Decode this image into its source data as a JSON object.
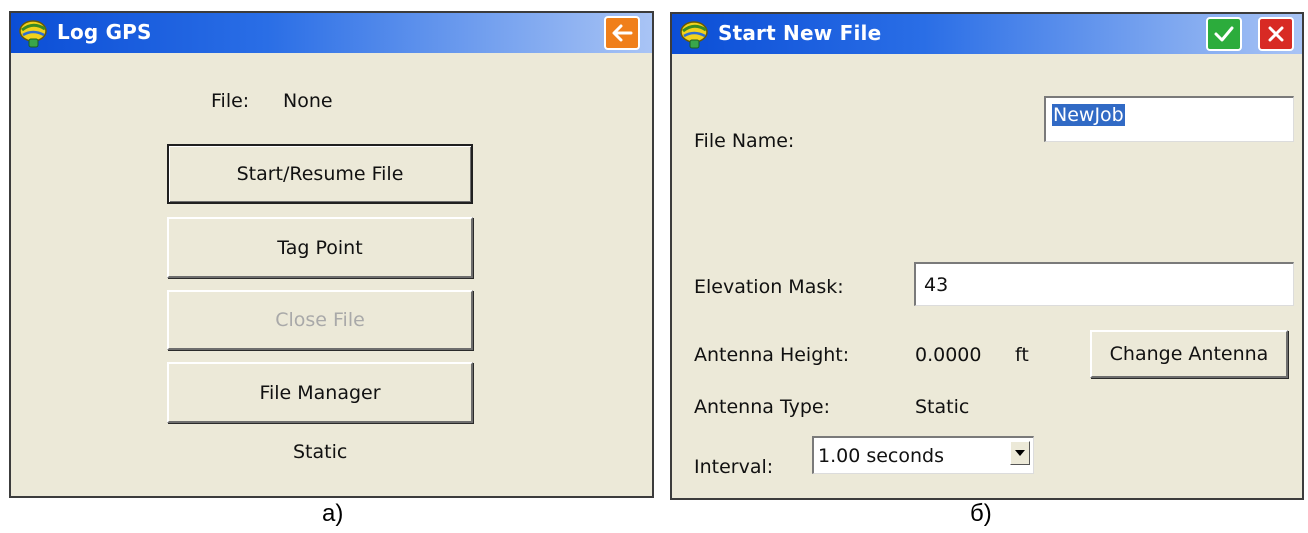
{
  "panel_a": {
    "title": "Log GPS",
    "file_label": "File:",
    "file_value": "None",
    "buttons": {
      "start_resume": "Start/Resume File",
      "tag_point": "Tag Point",
      "close_file": "Close File",
      "file_manager": "File Manager"
    },
    "mode_value": "Static",
    "caption": "a)",
    "icons": {
      "back": "back-arrow-icon",
      "logo": "app-logo-icon"
    }
  },
  "panel_b": {
    "title": "Start New File",
    "file_name_label": "File Name:",
    "file_name_value": "NewJob",
    "elevation_mask_label": "Elevation Mask:",
    "elevation_mask_value": "43",
    "antenna_height_label": "Antenna Height:",
    "antenna_height_value": "0.0000",
    "antenna_height_unit": "ft",
    "change_antenna_label": "Change Antenna",
    "antenna_type_label": "Antenna Type:",
    "antenna_type_value": "Static",
    "interval_label": "Interval:",
    "interval_value": "1.00 seconds",
    "caption": "б)",
    "icons": {
      "ok": "checkmark-icon",
      "cancel": "close-icon",
      "logo": "app-logo-icon"
    }
  },
  "colors": {
    "titlebar_start": "#0b4ed6",
    "titlebar_end": "#a9c4f5",
    "back_button": "#f07f1a",
    "ok_button": "#2cac3c",
    "cancel_button": "#d82a24",
    "selection": "#316ac5",
    "panel_bg": "#ece9d8"
  }
}
